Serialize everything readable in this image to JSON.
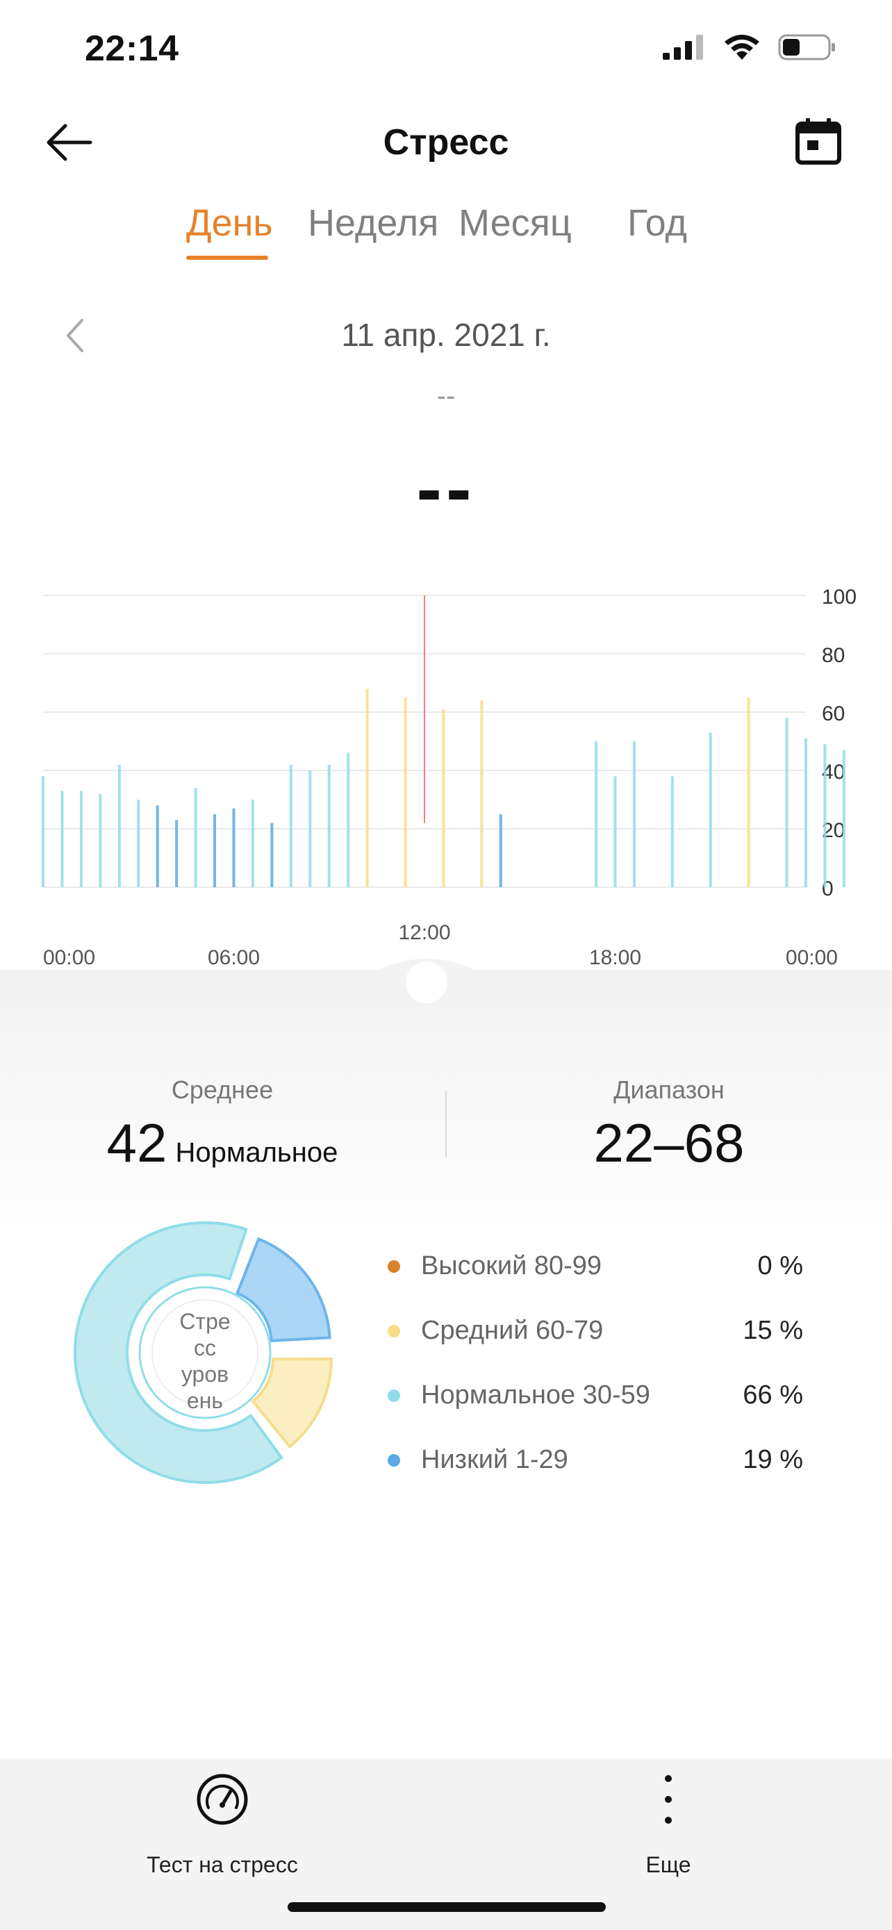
{
  "status_bar": {
    "time": "22:14"
  },
  "header": {
    "title": "Стресс"
  },
  "tabs": [
    {
      "label": "День",
      "active": true
    },
    {
      "label": "Неделя",
      "active": false
    },
    {
      "label": "Месяц",
      "active": false
    },
    {
      "label": "Год",
      "active": false
    }
  ],
  "date": {
    "label": "11 апр. 2021 г.",
    "sub_value": "--",
    "main_value": "--"
  },
  "colors": {
    "accent": "#e6822c",
    "high": "#d9822b",
    "medium": "#f8dd85",
    "normal": "#8fdde8",
    "low": "#5aa9e6",
    "marker": "#f08080"
  },
  "chart_data": {
    "type": "bar",
    "x_ticks": [
      "00:00",
      "06:00",
      "12:00",
      "18:00",
      "00:00"
    ],
    "y_ticks": [
      "100",
      "80",
      "60",
      "40",
      "20",
      "0"
    ],
    "ylim": [
      0,
      100
    ],
    "grid": true,
    "selected_time": "12:00",
    "bars": [
      {
        "t": 0.0,
        "v": 38
      },
      {
        "t": 0.6,
        "v": 33
      },
      {
        "t": 1.2,
        "v": 33
      },
      {
        "t": 1.8,
        "v": 32
      },
      {
        "t": 2.4,
        "v": 42
      },
      {
        "t": 3.0,
        "v": 30
      },
      {
        "t": 3.6,
        "v": 28
      },
      {
        "t": 4.2,
        "v": 23
      },
      {
        "t": 4.8,
        "v": 34
      },
      {
        "t": 5.4,
        "v": 25
      },
      {
        "t": 6.0,
        "v": 27
      },
      {
        "t": 6.6,
        "v": 30
      },
      {
        "t": 7.2,
        "v": 22
      },
      {
        "t": 7.8,
        "v": 42
      },
      {
        "t": 8.4,
        "v": 40
      },
      {
        "t": 9.0,
        "v": 42
      },
      {
        "t": 9.6,
        "v": 46
      },
      {
        "t": 10.2,
        "v": 68
      },
      {
        "t": 11.4,
        "v": 65
      },
      {
        "t": 12.6,
        "v": 61
      },
      {
        "t": 13.8,
        "v": 64
      },
      {
        "t": 14.4,
        "v": 25
      },
      {
        "t": 17.4,
        "v": 50
      },
      {
        "t": 18.0,
        "v": 38
      },
      {
        "t": 18.6,
        "v": 50
      },
      {
        "t": 19.8,
        "v": 38
      },
      {
        "t": 21.0,
        "v": 53
      },
      {
        "t": 22.2,
        "v": 65
      },
      {
        "t": 23.4,
        "v": 58
      },
      {
        "t": 24.0,
        "v": 51
      },
      {
        "t": 24.6,
        "v": 49
      },
      {
        "t": 25.2,
        "v": 47
      }
    ]
  },
  "summary": {
    "avg_label": "Среднее",
    "avg_value": "42",
    "avg_word": "Нормальное",
    "range_label": "Диапазон",
    "range_value": "22–68"
  },
  "donut": {
    "center_lines": [
      "Стре",
      "сс",
      "уров",
      "ень"
    ],
    "slices": [
      {
        "name": "Низкий",
        "percent": 19
      },
      {
        "name": "Средний",
        "percent": 15
      },
      {
        "name": "Нормальное",
        "percent": 66
      }
    ]
  },
  "legend": [
    {
      "label": "Высокий 80-99",
      "pct": "0 %",
      "color": "#d9822b"
    },
    {
      "label": "Средний 60-79",
      "pct": "15 %",
      "color": "#f8dd85"
    },
    {
      "label": "Нормальное 30-59",
      "pct": "66 %",
      "color": "#8fdde8"
    },
    {
      "label": "Низкий 1-29",
      "pct": "19 %",
      "color": "#5aa9e6"
    }
  ],
  "actions": {
    "stress_test": "Тест на стресс",
    "more": "Еще"
  }
}
